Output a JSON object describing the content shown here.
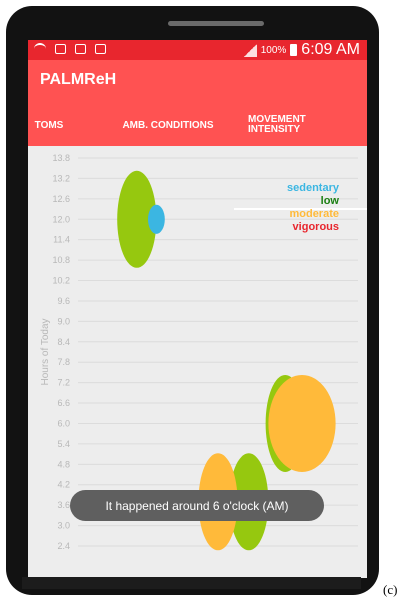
{
  "status_bar": {
    "battery_percent": "100%",
    "time": "6:09 AM"
  },
  "app": {
    "title": "PALMReH"
  },
  "tabs": [
    {
      "label": "TOMS"
    },
    {
      "label": "AMB. CONDITIONS"
    },
    {
      "label": "MOVEMENT",
      "label2": "INTENSITY",
      "selected": true
    }
  ],
  "toast": {
    "message": "It happened around 6 o'clock (AM)"
  },
  "caption": "(c)",
  "colors": {
    "accent": "#ff5252",
    "status_bar": "#e8262e",
    "sedentary": "#3bb6e2",
    "low": "#96c80f",
    "moderate": "#ffba3a",
    "vigorous": "#e8262e"
  },
  "chart_data": {
    "type": "scatter",
    "ylabel": "Hours of Today",
    "yticks": [
      "13.8",
      "13.2",
      "12.6",
      "12.0",
      "11.4",
      "10.8",
      "10.2",
      "9.6",
      "9.0",
      "8.4",
      "7.8",
      "7.2",
      "6.6",
      "6.0",
      "5.4",
      "4.8",
      "4.2",
      "3.6",
      "3.0",
      "2.4"
    ],
    "ylim": [
      2.4,
      13.8
    ],
    "grid": true,
    "legend_position": "top-right",
    "legend": [
      {
        "name": "sedentary",
        "color": "#3bb6e2"
      },
      {
        "name": "low",
        "color": "#1b7f12"
      },
      {
        "name": "moderate",
        "color": "#ffba3a"
      },
      {
        "name": "vigorous",
        "color": "#e8262e"
      }
    ],
    "series": [
      {
        "name": "low",
        "color": "#96c80f",
        "points": [
          {
            "x": 0.21,
            "y": 12.0,
            "w": 0.14
          },
          {
            "x": 0.74,
            "y": 6.0,
            "w": 0.14
          },
          {
            "x": 0.61,
            "y": 3.7,
            "w": 0.14
          }
        ]
      },
      {
        "name": "moderate",
        "color": "#ffba3a",
        "points": [
          {
            "x": 0.8,
            "y": 6.0,
            "w": 0.24
          },
          {
            "x": 0.5,
            "y": 3.7,
            "w": 0.14
          }
        ]
      },
      {
        "name": "sedentary",
        "color": "#3bb6e2",
        "points": [
          {
            "x": 0.28,
            "y": 12.0,
            "w": 0.06
          }
        ]
      }
    ]
  }
}
